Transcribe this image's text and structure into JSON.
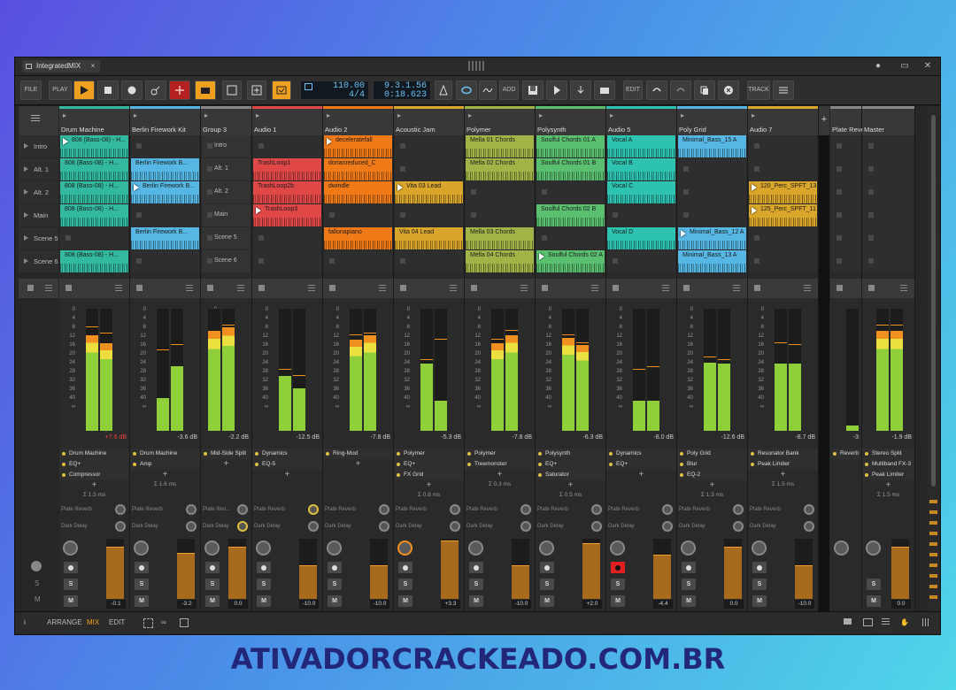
{
  "window": {
    "tab_title": "IntegratedMIX",
    "close_glyph": "×",
    "minimize_glyph": "●",
    "restore_glyph": "▭",
    "close_window_glyph": "✕"
  },
  "toolbar": {
    "file": "FILE",
    "play": "PLAY",
    "add": "ADD",
    "edit": "EDIT",
    "track": "TRACK",
    "tempo": "110.00",
    "signature": "4/4",
    "position": "9.3.1.56",
    "time": "0:18.623"
  },
  "scenes": [
    "Intro",
    "Alt. 1",
    "Alt. 2",
    "Main",
    "Scene 5",
    "Scene 6"
  ],
  "tracks": [
    {
      "name": "Drum Machine",
      "color": "#33b9a0",
      "db": "+7.6 dB",
      "db_red": true,
      "fader": "-0.1",
      "meter": [
        0.78,
        0.72
      ],
      "peak": [
        0.85,
        0.8
      ],
      "clips": [
        [
          "808 (Bass-08) - H...",
          true
        ],
        [
          "808 (Bass-08) - H...",
          false
        ],
        [
          "808 (Bass-08) - H...",
          false
        ],
        [
          "808 (Bass-08) - H...",
          false
        ],
        null,
        [
          "808 (Bass-08) - H...",
          false
        ]
      ],
      "fx": [
        "Drum Machine",
        "EQ+",
        "Compressor"
      ],
      "sum": "Σ 1.5 ms",
      "sends": [
        "Plate Reverb",
        "Dark Delay"
      ],
      "rec": false
    },
    {
      "name": "Berlin Firework Kit",
      "color": "#56b7e4",
      "db": "-3.6 dB",
      "db_red": false,
      "fader": "-3.2",
      "meter": [
        0.27,
        0.53
      ],
      "peak": [
        0.66,
        0.7
      ],
      "clips": [
        null,
        [
          "Berlin Firework B...",
          false
        ],
        [
          "Berlin Firework B...",
          true
        ],
        null,
        [
          "Berlin Firework B...",
          false
        ],
        null
      ],
      "fx": [
        "Drum Machine",
        "Amp"
      ],
      "sum": "Σ 1.6 ms",
      "sends": [
        "Plate Reverb",
        "Dark Delay"
      ],
      "rec": false
    },
    {
      "name": "Group 3",
      "color": "#888888",
      "db": "-2.2 dB",
      "db_red": false,
      "fader": "0.0",
      "meter": [
        0.82,
        0.85
      ],
      "peak": [
        0.8,
        0.86
      ],
      "clips": "scene",
      "fx": [
        "Mid-Side Split"
      ],
      "sum": "",
      "sends": [
        "Plate Rev...",
        "Dark Delay"
      ],
      "rec": false
    },
    {
      "name": "Audio 1",
      "color": "#e04848",
      "db": "-12.5 dB",
      "db_red": false,
      "fader": "-10.0",
      "meter": [
        0.45,
        0.35
      ],
      "peak": [
        0.5,
        0.45
      ],
      "clips": [
        null,
        [
          "TrashLoop1",
          false
        ],
        [
          "TrashLoop2b",
          false
        ],
        [
          "TrashLoop3",
          true
        ],
        null,
        null
      ],
      "fx": [
        "Dynamics",
        "EQ-5"
      ],
      "sum": "",
      "sends": [
        "Plate Reverb",
        "Dark Delay"
      ],
      "rec": false
    },
    {
      "name": "Audio 2",
      "color": "#f07a18",
      "db": "-7.8 dB",
      "db_red": false,
      "fader": "-10.0",
      "meter": [
        0.75,
        0.78
      ],
      "peak": [
        0.78,
        0.8
      ],
      "clips": [
        [
          "deceleratefall",
          true
        ],
        [
          "dorianreduced_C",
          false
        ],
        [
          "dwindle",
          false
        ],
        null,
        [
          "fallonapiano",
          false
        ],
        null
      ],
      "fx": [
        "Ring-Mod"
      ],
      "sum": "",
      "sends": [
        "Plate Reverb",
        "Dark Delay"
      ],
      "rec": false
    },
    {
      "name": "Acoustic Jam",
      "color": "#d9a52a",
      "db": "-5.3 dB",
      "db_red": false,
      "fader": "+3.3",
      "meter": [
        0.55,
        0.25
      ],
      "peak": [
        0.58,
        0.75
      ],
      "clips": [
        null,
        null,
        [
          "Vita 03 Lead",
          true
        ],
        null,
        [
          "Vita 04 Lead",
          false
        ],
        null
      ],
      "fx": [
        "Polymer",
        "EQ+",
        "FX Grid"
      ],
      "sum": "Σ 0.8 ms",
      "sends": [
        "Plate Reverb",
        "Dark Delay"
      ],
      "rec": false
    },
    {
      "name": "Polymer",
      "color": "#a2b448",
      "db": "-7.8 dB",
      "db_red": false,
      "fader": "-10.0",
      "meter": [
        0.72,
        0.78
      ],
      "peak": [
        0.75,
        0.82
      ],
      "clips": [
        [
          "Mella 01 Chords",
          false
        ],
        [
          "Mella 02 Chords",
          false
        ],
        null,
        null,
        [
          "Mella 03 Chords",
          false
        ],
        [
          "Mella 04 Chords",
          false
        ]
      ],
      "fx": [
        "Polymer",
        "Treemonster"
      ],
      "sum": "Σ 0.3 ms",
      "sends": [
        "Plate Reverb",
        "Dark Delay"
      ],
      "rec": false
    },
    {
      "name": "Polysynth",
      "color": "#5ac070",
      "db": "-6.3 dB",
      "db_red": false,
      "fader": "+2.0",
      "meter": [
        0.76,
        0.7
      ],
      "peak": [
        0.78,
        0.72
      ],
      "clips": [
        [
          "Soulful Chords 01 A",
          false
        ],
        [
          "Soulful Chords 01 B",
          false
        ],
        null,
        [
          "Soulful Chords 02 B",
          false
        ],
        null,
        [
          "Soulful Chords 02 A",
          true
        ]
      ],
      "fx": [
        "Polysynth",
        "EQ+",
        "Saturator"
      ],
      "sum": "Σ 0.5 ms",
      "sends": [
        "Plate Reverb",
        "Dark Delay"
      ],
      "rec": false
    },
    {
      "name": "Audio 5",
      "color": "#2ec2b0",
      "db": "-8.0 dB",
      "db_red": false,
      "fader": "-4.4",
      "meter": [
        0.25,
        0.25
      ],
      "peak": [
        0.5,
        0.52
      ],
      "clips": [
        [
          "Vocal A",
          false
        ],
        [
          "Vocal B",
          false
        ],
        [
          "Vocal C",
          false
        ],
        null,
        [
          "Vocal D",
          false
        ],
        null
      ],
      "fx": [
        "Dynamics",
        "EQ+"
      ],
      "sum": "",
      "sends": [
        "Plate Reverb",
        "Dark Delay"
      ],
      "rec": true
    },
    {
      "name": "Poly Grid",
      "color": "#56b7e4",
      "db": "-12.6 dB",
      "db_red": false,
      "fader": "0.0",
      "meter": [
        0.56,
        0.55
      ],
      "peak": [
        0.6,
        0.58
      ],
      "clips": [
        [
          "Minimal_Bass_15 A",
          false
        ],
        null,
        null,
        null,
        [
          "Minimal_Bass_12 A",
          true
        ],
        [
          "Minimal_Bass_13 A",
          false
        ]
      ],
      "fx": [
        "Poly Grid",
        "Blur",
        "EQ-2"
      ],
      "sum": "Σ 1.3 ms",
      "sends": [
        "Plate Reverb",
        "Dark Delay"
      ],
      "rec": false
    },
    {
      "name": "Audio 7",
      "color": "#d9a52a",
      "db": "-8.7 dB",
      "db_red": false,
      "fader": "-10.0",
      "meter": [
        0.55,
        0.55
      ],
      "peak": [
        0.72,
        0.7
      ],
      "clips": [
        null,
        null,
        [
          "120_Perc_SPFT_13",
          true
        ],
        [
          "125_Perc_SPFT_11",
          true
        ],
        null,
        null
      ],
      "fx": [
        "Resonator Bank",
        "Peak Limiter"
      ],
      "sum": "Σ 1.5 ms",
      "sends": [
        "Plate Reverb",
        "Dark Delay"
      ],
      "rec": false
    }
  ],
  "return_track": {
    "name": "Plate Reve",
    "db": "-3",
    "fx": "Reverb"
  },
  "master": {
    "name": "Master",
    "db": "-1.9 dB",
    "fader": "0.0",
    "fx": [
      "Stereo Split",
      "Multiband FX-3",
      "Peak Limiter"
    ],
    "sum": "Σ 1.5 ms"
  },
  "statusbar": {
    "arrange": "ARRANGE",
    "mix": "MIX",
    "edit": "EDIT"
  },
  "meter_scale": [
    "0",
    "4",
    "8",
    "12",
    "16",
    "20",
    "24",
    "28",
    "32",
    "36",
    "40",
    "∞"
  ],
  "watermark": "ATIVADORCRACKEADO.COM.BR",
  "colors": {
    "accent": "#f0a020",
    "record": "#e02020",
    "mix_active": "#f0a020"
  }
}
